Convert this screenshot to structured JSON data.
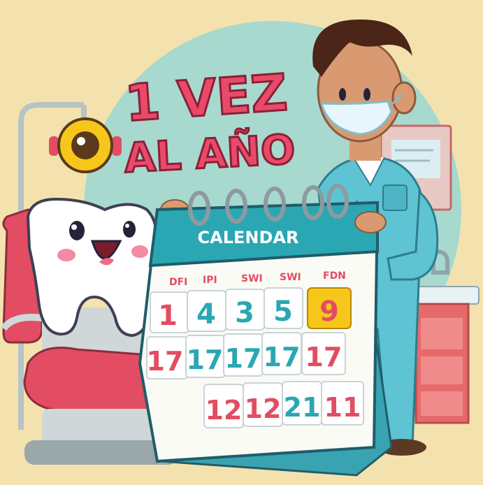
{
  "headline": {
    "line1": "1 VEZ",
    "line2": "AL AÑO"
  },
  "calendar": {
    "title": "CALENDAR",
    "weekdays": [
      "DFI",
      "IPI",
      "SWI",
      "SWI",
      "FDN"
    ],
    "rows": [
      [
        "1",
        "4",
        "3",
        "5",
        "9"
      ],
      [
        "17",
        "17",
        "17",
        "17",
        "17"
      ],
      [
        "",
        "12",
        "12",
        "21",
        "11"
      ]
    ]
  },
  "colors": {
    "background": "#f4e2ae",
    "headline": "#ea4a6a",
    "teal": "#2aa7b3",
    "scrub": "#5ec3d2",
    "highlight": "#f7c61a"
  }
}
